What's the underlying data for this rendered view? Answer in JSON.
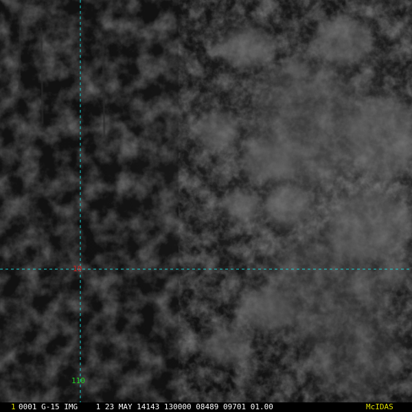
{
  "image": {
    "description_icon": "satellite-cloud-imagery",
    "grid_color": "#19d3d3",
    "background_color": "#101010"
  },
  "grid": {
    "latitude_label": "10",
    "latitude_label_color": "#d02020",
    "longitude_label": "110",
    "longitude_label_color": "#20d020"
  },
  "status_bar": {
    "frame_number": "1",
    "frame_number_color": "#e0e000",
    "text": "0001 G-15 IMG    1 23 MAY 14143 130000 08489 09701 01.00",
    "text_color": "#ffffff",
    "brand": "McIDAS",
    "brand_color": "#e0e000"
  }
}
